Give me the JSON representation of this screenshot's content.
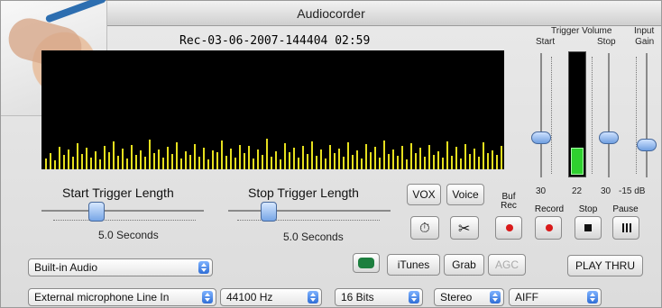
{
  "window": {
    "title": "Audiocorder"
  },
  "recording": {
    "name": "Rec-03-06-2007-144404",
    "time": "02:59"
  },
  "trigger_volume": {
    "title": "Trigger Volume",
    "start_label": "Start",
    "stop_label": "Stop",
    "input_gain_label": "Input\nGain",
    "values": [
      "30",
      "22",
      "30",
      "-15 dB"
    ]
  },
  "start_trigger": {
    "label": "Start Trigger Length",
    "value": "5.0 Seconds"
  },
  "stop_trigger": {
    "label": "Stop Trigger Length",
    "value": "5.0 Seconds"
  },
  "buttons": {
    "vox": "VOX",
    "voice": "Voice",
    "buf_rec": "Buf\nRec",
    "record": "Record",
    "stop": "Stop",
    "pause": "Pause",
    "itunes": "iTunes",
    "grab": "Grab",
    "agc": "AGC",
    "play_thru": "PLAY THRU"
  },
  "selects": {
    "device": "Built-in Audio",
    "source": "External microphone Line In",
    "rate": "44100 Hz",
    "bits": "16 Bits",
    "channels": "Stereo",
    "format": "AIFF"
  },
  "levels": {
    "meter_fill": 0.22,
    "start_knob": 0.35,
    "stop_knob": 0.35,
    "gain_knob": 0.29,
    "start_trigger_pos": 0.34,
    "stop_trigger_pos": 0.25
  },
  "icons": [
    "timer-icon",
    "scissors-icon",
    "phone-icon"
  ]
}
